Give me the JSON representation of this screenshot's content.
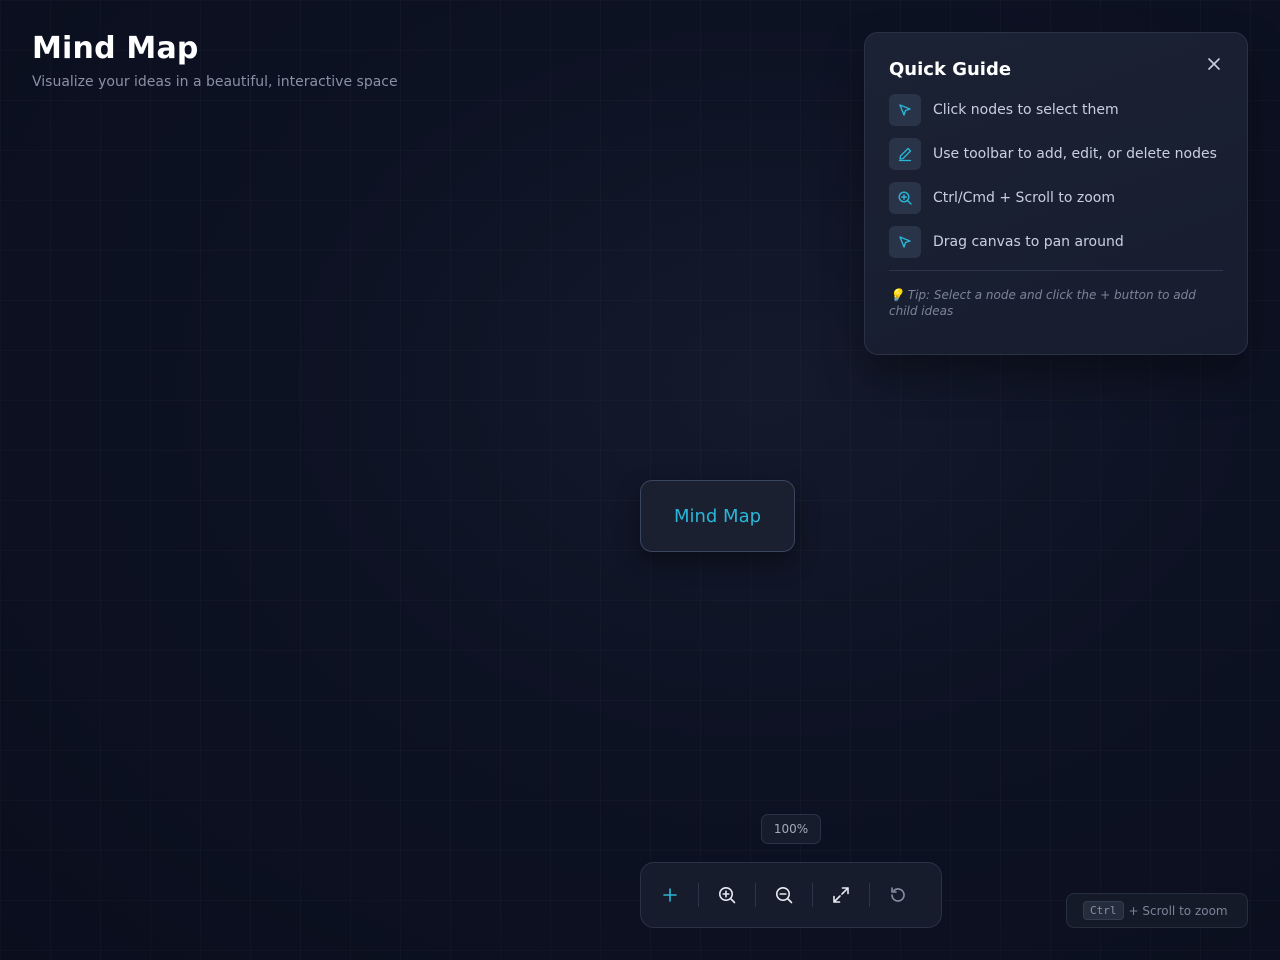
{
  "header": {
    "title": "Mind Map",
    "subtitle": "Visualize your ideas in a beautiful, interactive space"
  },
  "guide": {
    "title": "Quick Guide",
    "close_icon": "close-icon",
    "items": [
      {
        "icon": "cursor-icon",
        "text": "Click nodes to select them"
      },
      {
        "icon": "pencil-icon",
        "text": "Use toolbar to add, edit, or delete nodes"
      },
      {
        "icon": "zoom-in-icon",
        "text": "Ctrl/Cmd + Scroll to zoom"
      },
      {
        "icon": "cursor-icon",
        "text": "Drag canvas to pan around"
      }
    ],
    "tip": "💡 Tip: Select a node and click the + button to add child ideas"
  },
  "canvas": {
    "root_node": "Mind Map"
  },
  "zoom": {
    "level": "100%"
  },
  "toolbar": {
    "buttons": [
      "add-node-icon",
      "zoom-in-icon",
      "zoom-out-icon",
      "fit-view-icon",
      "reset-icon"
    ]
  },
  "hint": {
    "key": "Ctrl",
    "text": "+ Scroll to zoom"
  },
  "colors": {
    "accent": "#29b6d8",
    "background": "#0d1223",
    "panel": "#1b2234"
  }
}
